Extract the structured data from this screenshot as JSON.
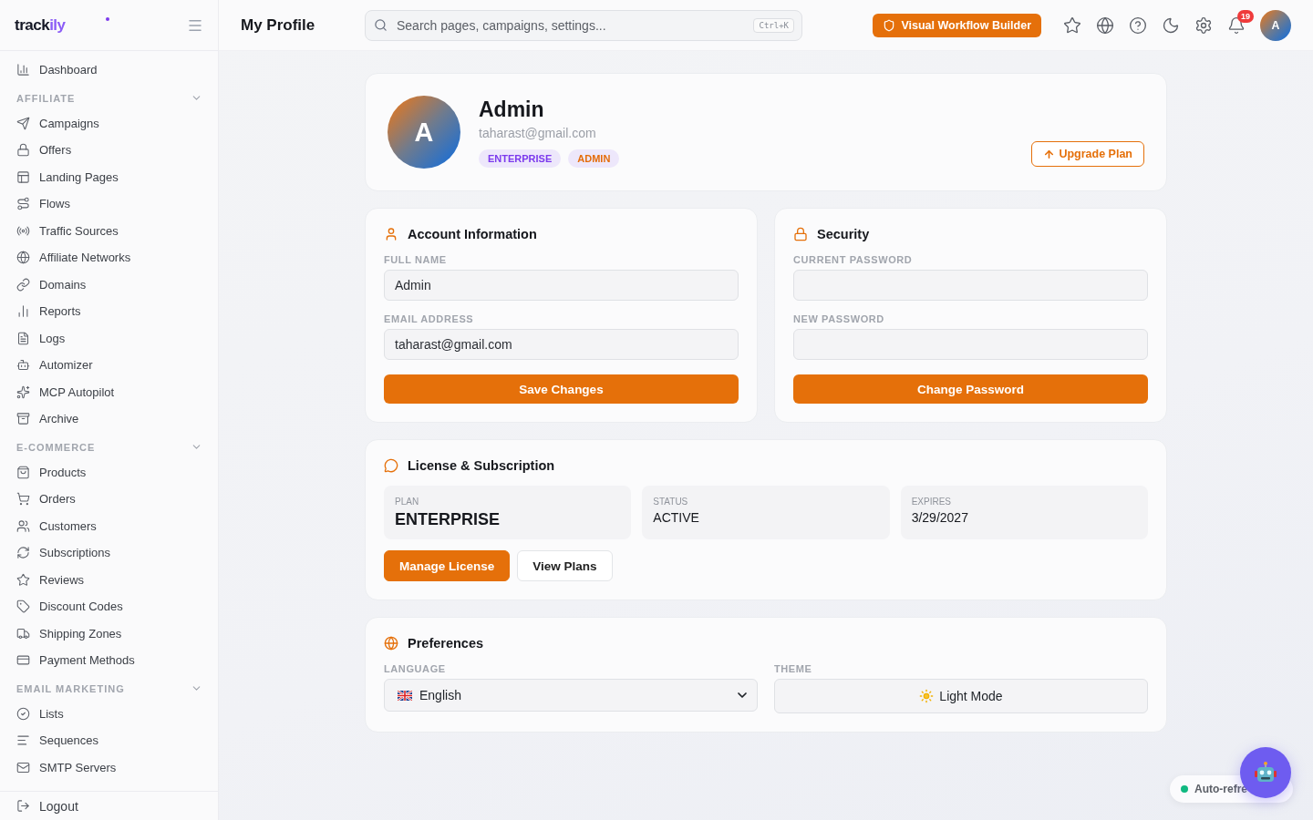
{
  "sidebar": {
    "logo": {
      "text": "track",
      "accent": "ily"
    },
    "items": [
      {
        "label": "Dashboard",
        "selected": false
      }
    ],
    "sections": [
      {
        "title": "AFFILIATE",
        "expanded": true,
        "items": [
          {
            "label": "Campaigns",
            "selected": false
          },
          {
            "label": "Offers",
            "selected": false
          },
          {
            "label": "Landing Pages",
            "selected": false
          },
          {
            "label": "Flows",
            "selected": false
          },
          {
            "label": "Traffic Sources",
            "selected": false
          },
          {
            "label": "Affiliate Networks",
            "selected": false
          },
          {
            "label": "Domains",
            "selected": false
          },
          {
            "label": "Reports",
            "selected": false
          },
          {
            "label": "Logs",
            "selected": false
          },
          {
            "label": "Automizer",
            "selected": false
          },
          {
            "label": "MCP Autopilot",
            "selected": false
          },
          {
            "label": "Archive",
            "selected": false
          }
        ]
      },
      {
        "title": "E-COMMERCE",
        "expanded": true,
        "items": [
          {
            "label": "Products",
            "selected": false
          },
          {
            "label": "Orders",
            "selected": false
          },
          {
            "label": "Customers",
            "selected": false
          },
          {
            "label": "Subscriptions",
            "selected": false
          },
          {
            "label": "Reviews",
            "selected": false
          },
          {
            "label": "Discount Codes",
            "selected": false
          },
          {
            "label": "Shipping Zones",
            "selected": false
          },
          {
            "label": "Payment Methods",
            "selected": false
          }
        ]
      },
      {
        "title": "EMAIL MARKETING",
        "expanded": true,
        "items": [
          {
            "label": "Lists",
            "selected": false
          },
          {
            "label": "Sequences",
            "selected": false
          },
          {
            "label": "SMTP Servers",
            "selected": false
          }
        ]
      }
    ],
    "footer": {
      "label": "Logout"
    }
  },
  "header": {
    "title": "My Profile",
    "search": {
      "placeholder": "Search pages, campaigns, settings...",
      "shortcut": "Ctrl+K"
    },
    "workflow_button": "Visual Workflow Builder",
    "notification_count": "19",
    "avatar": "A"
  },
  "profile": {
    "avatar": "A",
    "name": "Admin",
    "email": "taharast@gmail.com",
    "badges": [
      {
        "label": "ENTERPRISE",
        "color": "#7c3aed"
      },
      {
        "label": "ADMIN",
        "color": "#e46c0a"
      }
    ],
    "upgrade_button": "Upgrade Plan"
  },
  "account": {
    "title": "Account Information",
    "fields": [
      {
        "label": "FULL NAME",
        "value": "Admin"
      },
      {
        "label": "EMAIL ADDRESS",
        "value": "taharast@gmail.com"
      }
    ],
    "button": "Save Changes"
  },
  "security": {
    "title": "Security",
    "fields": [
      {
        "label": "CURRENT PASSWORD"
      },
      {
        "label": "NEW PASSWORD"
      }
    ],
    "button": "Change Password"
  },
  "license": {
    "title": "License & Subscription",
    "tiles": [
      {
        "label": "PLAN",
        "value": "ENTERPRISE",
        "kind": "large"
      },
      {
        "label": "STATUS",
        "value": "ACTIVE",
        "kind": "normal"
      },
      {
        "label": "EXPIRES",
        "value": "3/29/2027",
        "kind": "normal"
      }
    ],
    "buttons": [
      {
        "label": "Manage License",
        "kind": "primary"
      },
      {
        "label": "View Plans",
        "kind": "secondary"
      }
    ]
  },
  "preferences": {
    "title": "Preferences",
    "language": {
      "label": "LANGUAGE",
      "value": "English"
    },
    "theme": {
      "label": "THEME",
      "value": "Light Mode"
    }
  },
  "auto_refresh": {
    "label": "Auto-refre"
  }
}
